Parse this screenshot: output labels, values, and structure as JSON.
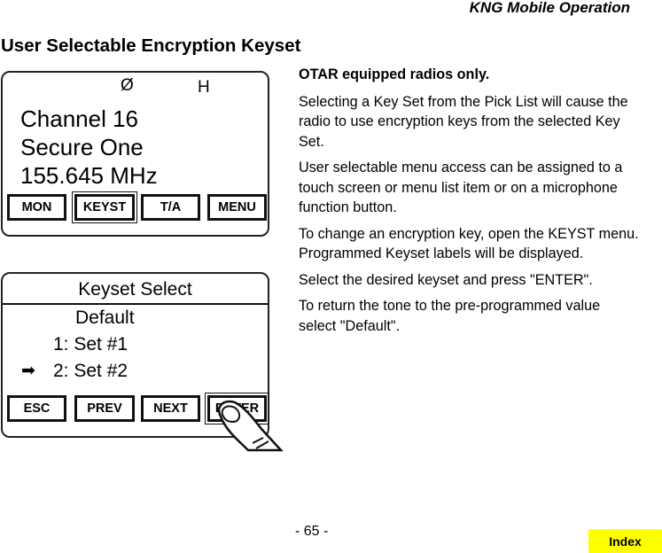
{
  "header": {
    "running_title": "KNG Mobile Operation"
  },
  "page_title": "User Selectable Encryption Keyset",
  "radio_main_screen": {
    "status_icons": [
      {
        "name": "encryption-icon",
        "glyph": "Ø"
      },
      {
        "name": "high-power-icon",
        "glyph": "H"
      }
    ],
    "lines": [
      "Channel 16",
      "Secure One",
      "155.645 MHz"
    ],
    "softkeys": [
      {
        "label": "MON",
        "selected": false
      },
      {
        "label": "KEYST",
        "selected": true
      },
      {
        "label": "T/A",
        "selected": false
      },
      {
        "label": "MENU",
        "selected": false
      }
    ]
  },
  "radio_keyset_screen": {
    "title": "Keyset Select",
    "items": [
      {
        "label": "Default",
        "selected": false
      },
      {
        "label": "1: Set #1",
        "selected": false
      },
      {
        "label": "2: Set #2",
        "selected": true
      }
    ],
    "selector_glyph": "➡",
    "softkeys": [
      {
        "label": "ESC",
        "selected": false
      },
      {
        "label": "PREV",
        "selected": false
      },
      {
        "label": "NEXT",
        "selected": false
      },
      {
        "label": "ENTER",
        "selected": true
      }
    ]
  },
  "body": {
    "lead": "OTAR equipped radios only.",
    "paragraphs": [
      "Selecting a Key Set from the Pick List will cause the radio to use encryption keys from the selected Key Set.",
      "User selectable menu access can be assigned to a touch screen or menu list item or on a microphone function button.",
      "To change an encryption key, open the KEYST menu. Programmed Keyset labels will be displayed.",
      "Select the desired keyset and press \"ENTER\".",
      "To return the tone to the pre-programmed value select \"Default\"."
    ]
  },
  "footer": {
    "page_number": "- 65 -",
    "index_label": "Index",
    "index_color": "#ffff00"
  }
}
